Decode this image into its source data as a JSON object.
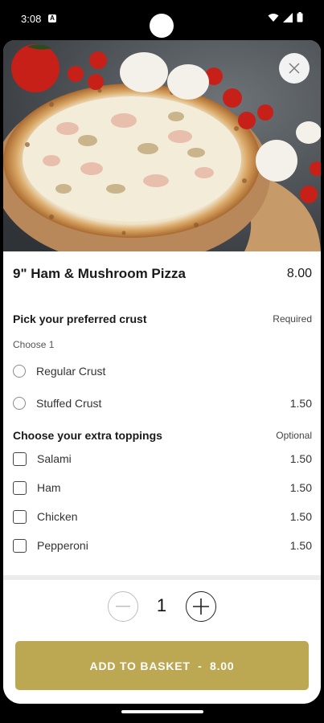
{
  "status_bar": {
    "time": "3:08",
    "notification_icon": "a-badge-icon",
    "icons": [
      "wifi-icon",
      "signal-icon",
      "battery-icon"
    ]
  },
  "hero": {
    "image": "pizza-photo",
    "close_icon": "close-icon"
  },
  "product": {
    "title": "9\" Ham & Mushroom Pizza",
    "price": "8.00"
  },
  "crust_section": {
    "title": "Pick your preferred crust",
    "tag": "Required",
    "subtitle": "Choose 1",
    "options": [
      {
        "label": "Regular Crust",
        "price": ""
      },
      {
        "label": "Stuffed Crust",
        "price": "1.50"
      }
    ]
  },
  "toppings_section": {
    "title": "Choose your extra toppings",
    "tag": "Optional",
    "options": [
      {
        "label": "Salami",
        "price": "1.50"
      },
      {
        "label": "Ham",
        "price": "1.50"
      },
      {
        "label": "Chicken",
        "price": "1.50"
      },
      {
        "label": "Pepperoni",
        "price": "1.50"
      }
    ]
  },
  "quantity": {
    "value": "1"
  },
  "add_button": {
    "label": "ADD TO BASKET  -  8.00"
  },
  "colors": {
    "accent": "#bca753",
    "text": "#1a1a1a"
  }
}
